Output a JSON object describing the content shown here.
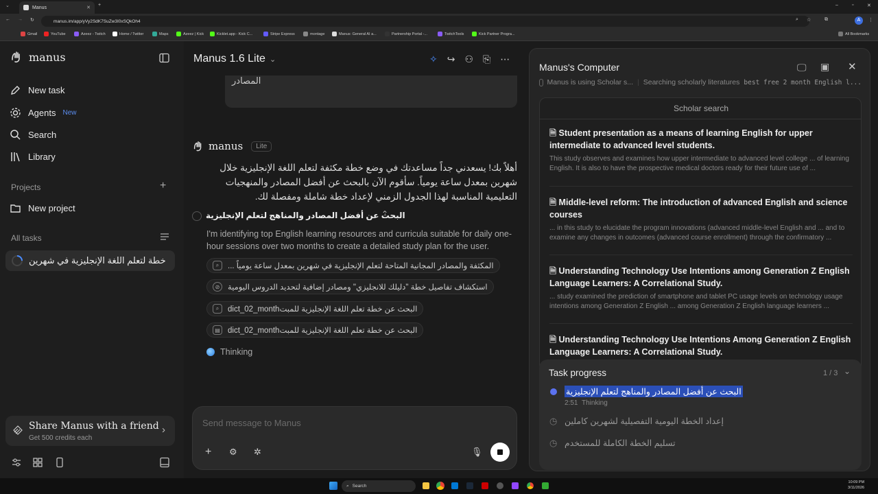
{
  "browser": {
    "tab_title": "Manus",
    "url": "manus.im/app/yVy2SdK7SuZw3I0xSQkOh4",
    "bookmarks": [
      "Gmail",
      "YouTube",
      "Azeez - Twitch",
      "Home / Twitter",
      "Maps",
      "Azeez | Kick",
      "Kicklet.app - Kick C...",
      "Stripe Express",
      "montage",
      "Manus: General AI a...",
      "Partnership Portal -...",
      "TwitchTools",
      "Kick Partner Progra..."
    ],
    "all_bookmarks": "All Bookmarks"
  },
  "sidebar": {
    "logo": "manus",
    "nav": [
      {
        "label": "New task",
        "icon": "edit-icon"
      },
      {
        "label": "Agents",
        "icon": "agents-icon",
        "badge": "New"
      },
      {
        "label": "Search",
        "icon": "search-icon"
      },
      {
        "label": "Library",
        "icon": "library-icon"
      }
    ],
    "projects_label": "Projects",
    "new_project": "New project",
    "all_tasks_label": "All tasks",
    "task": "خطة لتعلم اللغة الإنجليزية في شهرين",
    "share_title": "Share Manus with a friend",
    "share_sub": "Get 500 credits each"
  },
  "chat": {
    "model": "Manus 1.6 Lite",
    "user_bubble_tail": "المصادر",
    "agent_name": "manus",
    "agent_badge": "Lite",
    "reply": "أهلاً بك! يسعدني جداً مساعدتك في وضع خطة مكثفة لتعلم اللغة الإنجليزية خلال شهرين بمعدل ساعة يومياً. سأقوم الآن بالبحث عن أفضل المصادر والمنهجيات التعليمية المناسبة لهذا الجدول الزمني لإعداد خطة شاملة ومفصلة لك.",
    "phase_title": "البحث عن أفضل المصادر والمناهج لتعلم الإنجليزية",
    "phase_desc": "I'm identifying top English learning resources and curricula suitable for daily one-hour sessions over two months to create a detailed study plan for the user.",
    "steps": [
      {
        "icon": "search-icon",
        "text": "المكثفة والمصادر المجانية المتاحة لتعلم الإنجليزية في شهرين بمعدل ساعة يومياً ..."
      },
      {
        "icon": "compass-icon",
        "text": "استكشاف تفاصيل خطة \"دليلك للانجليزي\" ومصادر إضافية لتحديد الدروس اليومية"
      },
      {
        "icon": "search-icon",
        "text": "البحث عن خطة تعلم اللغة الإنجليزية للمبتdict_02_month"
      },
      {
        "icon": "scholar-icon",
        "text": "البحث عن خطة تعلم اللغة الإنجليزية للمبتdict_02_month"
      }
    ],
    "thinking": "Thinking",
    "input_placeholder": "Send message to Manus"
  },
  "computer": {
    "title": "Manus's Computer",
    "using": "Manus is using Scholar s...",
    "status": "Searching scholarly literatures",
    "query": "best free 2 month English l...",
    "search_header": "Scholar search",
    "results": [
      {
        "title": "Student presentation as a means of learning English for upper intermediate to advanced level students.",
        "desc": "This study observes and examines how upper intermediate to advanced level college ... of learning English. It is also to have the prospective medical doctors ready for their future use of ..."
      },
      {
        "title": "Middle-level reform: The introduction of advanced English and science courses",
        "desc": "... in this study to elucidate the program innovations (advanced middle-level English and ... and to examine any changes in outcomes (advanced course enrollment) through the confirmatory ..."
      },
      {
        "title": "Understanding Technology Use Intentions among Generation Z English Language Learners: A Correlational Study.",
        "desc": "... study examined the prediction of smartphone and tablet PC usage levels on technology usage intentions among Generation Z English ... among Generation Z English language learners ..."
      },
      {
        "title": "Understanding Technology Use Intentions Among Generation Z English Language Learners: A Correlational Study.",
        "desc": ""
      }
    ],
    "progress": {
      "title": "Task progress",
      "count": "1 / 3",
      "items": [
        {
          "text": "البحث عن أفضل المصادر والمناهج لتعلم الإنجليزية",
          "time": "2:51",
          "status": "Thinking"
        },
        {
          "text": "إعداد الخطة اليومية التفصيلية لشهرين كاملين"
        },
        {
          "text": "تسليم الخطة الكاملة للمستخدم"
        }
      ]
    }
  },
  "taskbar": {
    "search": "Search",
    "time": "10:09 PM",
    "date": "3/11/2026"
  }
}
